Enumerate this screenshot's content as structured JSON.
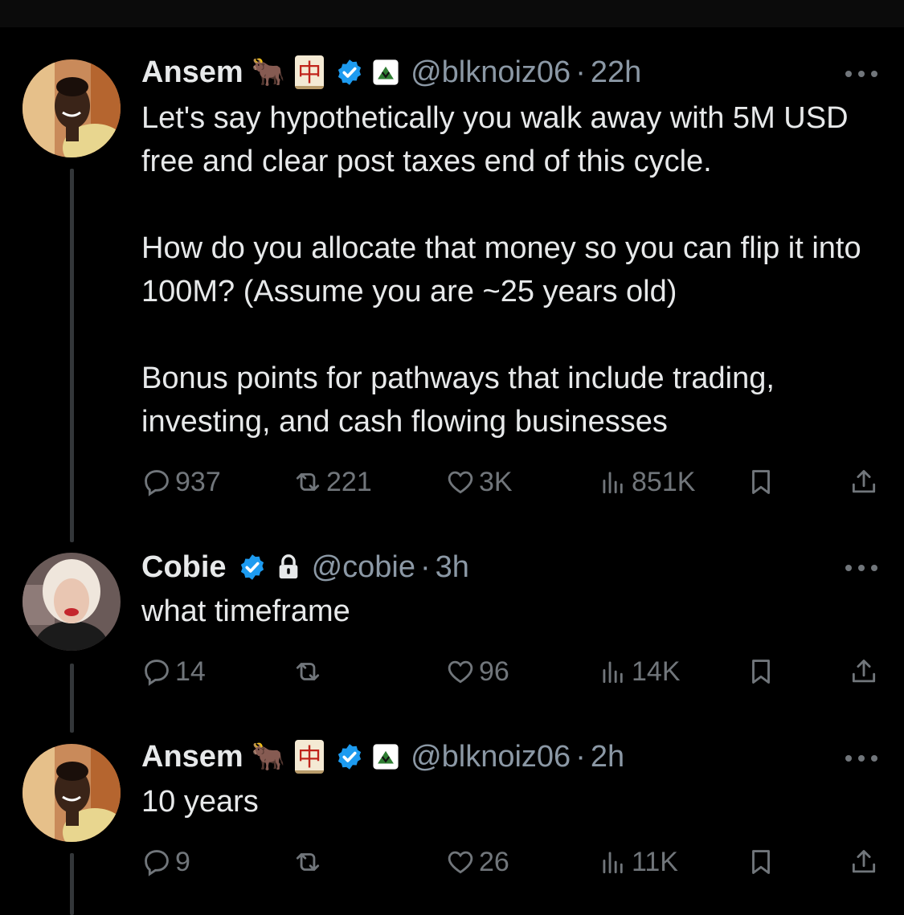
{
  "tweets": [
    {
      "name": "Ansem",
      "emoji_1": "🐂",
      "emoji_2": "中",
      "handle": "@blknoiz06",
      "dot": "·",
      "time": "22h",
      "text": "Let's say hypothetically you walk away with 5M USD free and clear post taxes end of this cycle.\n\nHow do you allocate that money so you can flip it into 100M? (Assume you are ~25 years old)\n\nBonus points for pathways that include trading, investing, and cash flowing businesses",
      "replies": "937",
      "reposts": "221",
      "likes": "3K",
      "views": "851K"
    },
    {
      "name": "Cobie",
      "handle": "@cobie",
      "dot": "·",
      "time": "3h",
      "text": "what timeframe",
      "replies": "14",
      "reposts": "",
      "likes": "96",
      "views": "14K"
    },
    {
      "name": "Ansem",
      "emoji_1": "🐂",
      "emoji_2": "中",
      "handle": "@blknoiz06",
      "dot": "·",
      "time": "2h",
      "text": "10 years",
      "replies": "9",
      "reposts": "",
      "likes": "26",
      "views": "11K"
    }
  ],
  "icons": {
    "reply": "reply-icon",
    "repost": "repost-icon",
    "like": "like-icon",
    "views": "views-icon",
    "bookmark": "bookmark-icon",
    "share": "share-icon",
    "verified": "verified-badge-icon",
    "lock": "lock-icon",
    "more": "more-icon"
  },
  "colors": {
    "background": "#000000",
    "text": "#e7e9ea",
    "secondary": "#71767b",
    "verified": "#1d9bf0"
  }
}
